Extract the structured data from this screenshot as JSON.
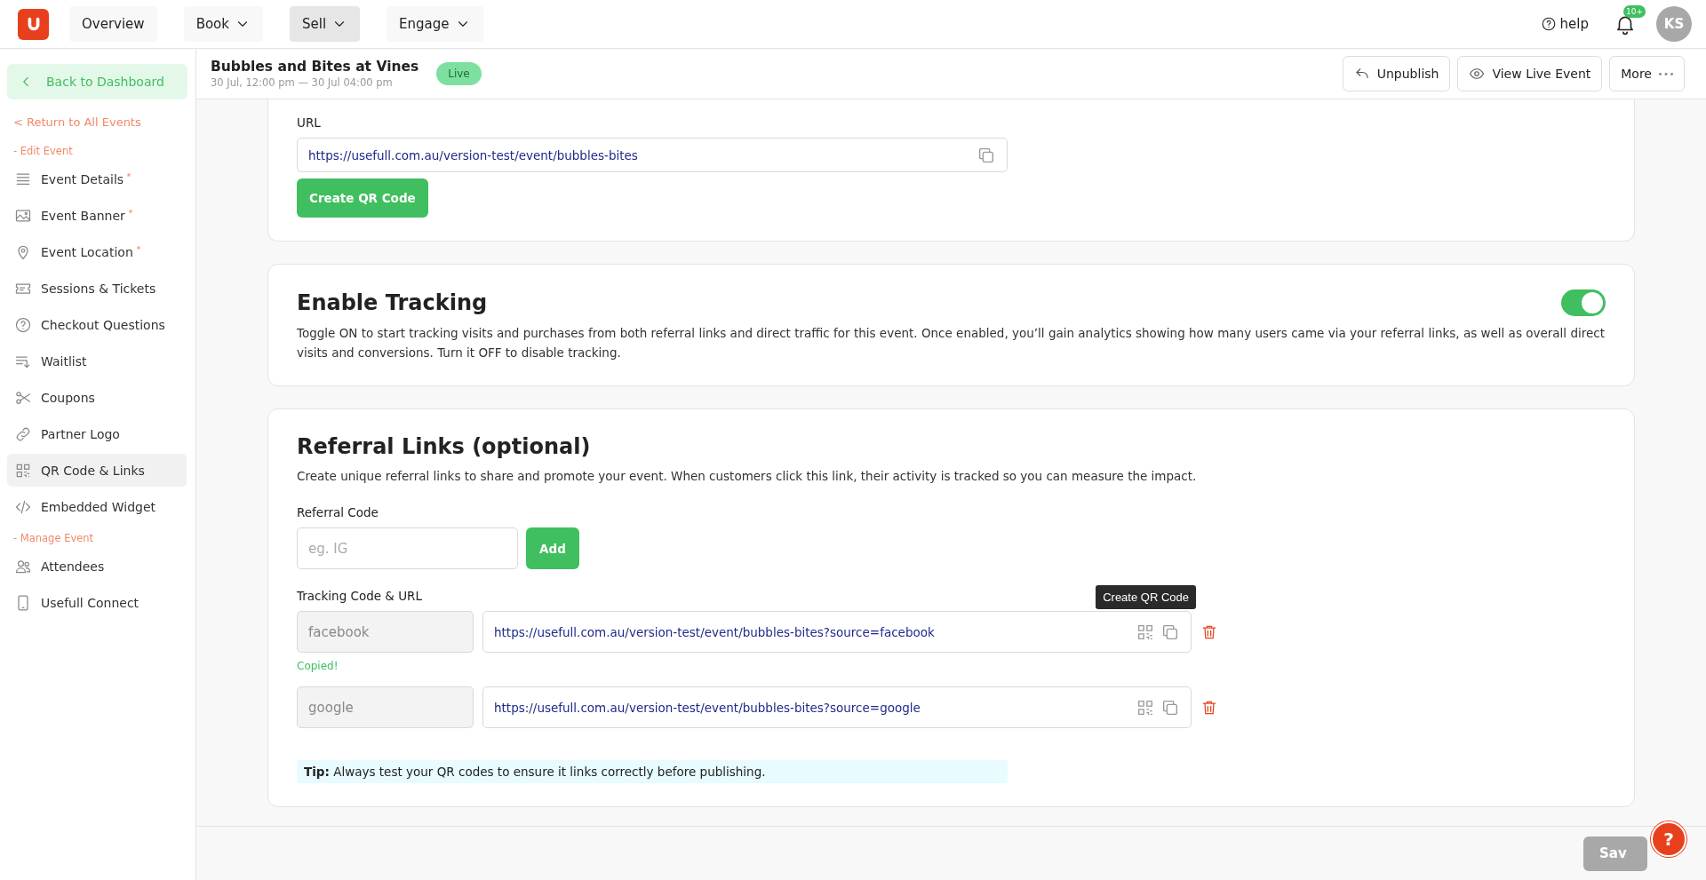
{
  "topbar": {
    "nav": [
      {
        "label": "Overview",
        "dropdown": false,
        "selected": false
      },
      {
        "label": "Book",
        "dropdown": true,
        "selected": false
      },
      {
        "label": "Sell",
        "dropdown": true,
        "selected": true
      },
      {
        "label": "Engage",
        "dropdown": true,
        "selected": false
      }
    ],
    "help": "help",
    "notifications": "10+",
    "avatar": "KS"
  },
  "sidebar": {
    "back": "Back to Dashboard",
    "return": "< Return to All Events",
    "sections": [
      {
        "heading": "- Edit Event",
        "items": [
          {
            "kind": "details",
            "label": "Event Details",
            "required": true,
            "selected": false
          },
          {
            "kind": "banner",
            "label": "Event Banner",
            "required": true,
            "selected": false
          },
          {
            "kind": "location",
            "label": "Event Location",
            "required": true,
            "selected": false
          },
          {
            "kind": "tickets",
            "label": "Sessions & Tickets",
            "required": false,
            "selected": false
          },
          {
            "kind": "questions",
            "label": "Checkout Questions",
            "required": false,
            "selected": false
          },
          {
            "kind": "waitlist",
            "label": "Waitlist",
            "required": false,
            "selected": false
          },
          {
            "kind": "coupons",
            "label": "Coupons",
            "required": false,
            "selected": false
          },
          {
            "kind": "partner",
            "label": "Partner Logo",
            "required": false,
            "selected": false
          },
          {
            "kind": "qr",
            "label": "QR Code & Links",
            "required": false,
            "selected": true
          },
          {
            "kind": "widget",
            "label": "Embedded Widget",
            "required": false,
            "selected": false
          }
        ]
      },
      {
        "heading": "- Manage Event",
        "items": [
          {
            "kind": "attendees",
            "label": "Attendees",
            "required": false,
            "selected": false
          },
          {
            "kind": "connect",
            "label": "Usefull Connect",
            "required": false,
            "selected": false
          }
        ]
      }
    ]
  },
  "header": {
    "title": "Bubbles and Bites at Vines",
    "dates": "30 Jul, 12:00 pm — 30 Jul 04:00 pm",
    "status": "Live",
    "actions": [
      {
        "kind": "unpublish",
        "label": "Unpublish"
      },
      {
        "kind": "view",
        "label": "View Live Event"
      },
      {
        "kind": "more",
        "label": "More"
      }
    ]
  },
  "url_card": {
    "label": "URL",
    "value": "https://usefull.com.au/version-test/event/bubbles-bites",
    "button": "Create QR Code"
  },
  "tracking_card": {
    "title": "Enable Tracking",
    "description": "Toggle ON to start tracking visits and purchases from both referral links and direct traffic for this event. Once enabled, you’ll gain analytics showing how many users came via your referral links, as well as overall direct visits and conversions. Turn it OFF to disable tracking.",
    "on": true
  },
  "referral_card": {
    "title": "Referral Links (optional)",
    "description": "Create unique referral links to share and promote your event. When customers click this link, their activity is tracked so you can measure the impact.",
    "code_label": "Referral Code",
    "code_placeholder": "eg. IG",
    "add_button": "Add",
    "links_label": "Tracking Code & URL",
    "links": [
      {
        "code": "facebook",
        "url": "https://usefull.com.au/version-test/event/bubbles-bites?source=facebook",
        "tooltip": "Create QR Code",
        "message": "Copied!"
      },
      {
        "code": "google",
        "url": "https://usefull.com.au/version-test/event/bubbles-bites?source=google"
      }
    ],
    "tip": "**Tip:** Always test your QR codes to ensure it links correctly before publishing."
  },
  "footer": {
    "save": "Sav",
    "save_disabled": true,
    "help_fab": "?"
  }
}
